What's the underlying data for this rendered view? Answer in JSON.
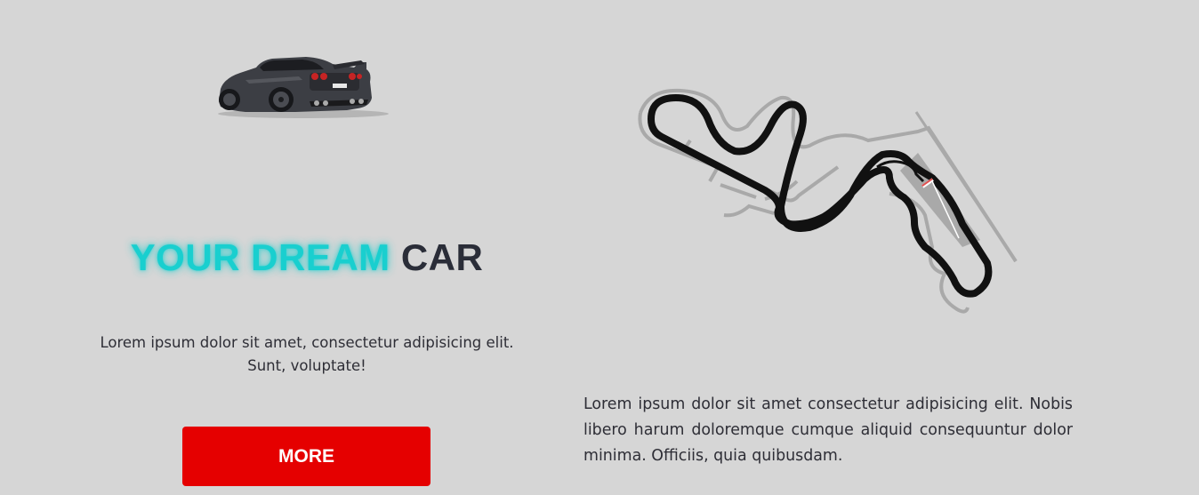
{
  "hero": {
    "title_accent": "YOUR DREAM",
    "title_rest": "CAR",
    "tagline": "Lorem ipsum dolor sit amet, consectetur adipisicing elit. Sunt, voluptate!",
    "button_label": "MORE"
  },
  "track_section": {
    "description": "Lorem ipsum dolor sit amet consectetur adipisicing elit. Nobis libero harum doloremque cumque aliquid consequuntur dolor minima. Officiis, quia quibusdam."
  },
  "colors": {
    "background": "#d6d6d6",
    "accent": "#19cfcf",
    "button": "#e50000",
    "text_dark": "#2a2d38"
  }
}
